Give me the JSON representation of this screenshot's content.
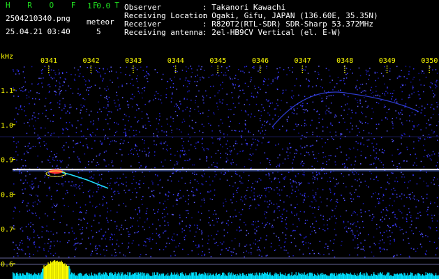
{
  "app": {
    "name": "H R O F F T",
    "version": "1.0.0",
    "filename": "2504210340.png",
    "datetime": "25.04.21 03:40",
    "meteor_label": "meteor",
    "meteor_count": "5"
  },
  "info": {
    "labels": [
      "Observer",
      "Receiving Location",
      "Receiver",
      "Receiving antenna"
    ],
    "values": [
      ": Takanori Kawachi",
      ": Ogaki, Gifu, JAPAN (136.60E, 35.35N)",
      ": R820T2(RTL-SDR) SDR-Sharp 53.372MHz",
      ": 2el-HB9CV Vertical (el. E-W)"
    ]
  },
  "axis": {
    "y_unit": "kHz",
    "y_ticks": [
      "1.1",
      "1.0",
      "0.9",
      "0.8",
      "0.7",
      "0.6"
    ],
    "x_ticks": [
      "0341",
      "0342",
      "0343",
      "0344",
      "0345",
      "0346",
      "0347",
      "0348",
      "0349",
      "0350"
    ]
  },
  "colors": {
    "background": "#000000",
    "noise": "#1a1acc",
    "carrier": "#ffffff",
    "meteor_head": "#ff2020",
    "meteor_trail": "#20e0ff",
    "level_bars": "#00e0ff",
    "level_peak": "#ffff00",
    "axis_text": "#ffff00",
    "header_green": "#20e020"
  }
}
